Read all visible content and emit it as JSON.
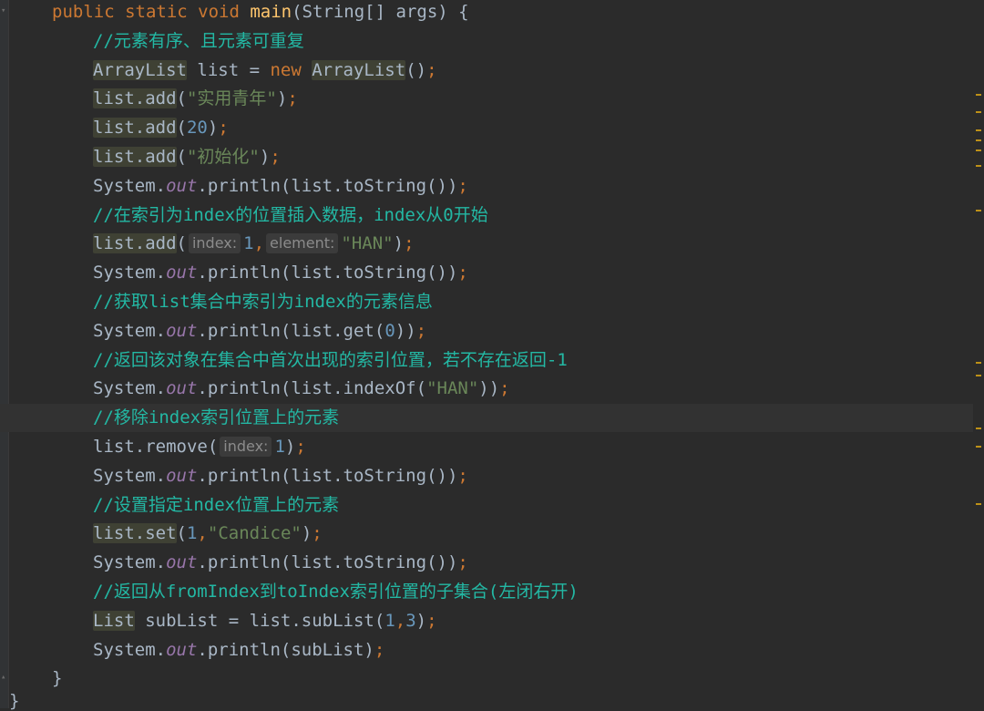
{
  "editor": {
    "colors": {
      "background": "#2b2b2b",
      "default_text": "#a9b7c6",
      "keyword": "#cc7832",
      "method_decl": "#ffc66d",
      "string": "#6a8759",
      "number": "#6897bb",
      "comment": "#23b8a4",
      "static_field": "#9876aa",
      "hint": "#8b8b8b",
      "marker": "#be9117"
    },
    "lines": [
      {
        "indent": 1,
        "tokens": [
          {
            "t": "public static void ",
            "c": "keyword"
          },
          {
            "t": "main",
            "c": "method_decl"
          },
          {
            "t": "(String[] args) {",
            "c": "default_text"
          }
        ]
      },
      {
        "indent": 2,
        "tokens": [
          {
            "t": "//元素有序、且元素可重复",
            "c": "comment"
          }
        ]
      },
      {
        "indent": 2,
        "tokens": [
          {
            "t": "ArrayList",
            "c": "default_text",
            "hl": true
          },
          {
            "t": " list = ",
            "c": "default_text"
          },
          {
            "t": "new ",
            "c": "keyword"
          },
          {
            "t": "ArrayList",
            "c": "default_text",
            "hl": true
          },
          {
            "t": "()",
            "c": "default_text"
          },
          {
            "t": ";",
            "c": "keyword"
          }
        ]
      },
      {
        "indent": 2,
        "tokens": [
          {
            "t": "list.add",
            "c": "default_text",
            "hl": true
          },
          {
            "t": "(",
            "c": "default_text"
          },
          {
            "t": "\"实用青年\"",
            "c": "string"
          },
          {
            "t": ")",
            "c": "default_text"
          },
          {
            "t": ";",
            "c": "keyword"
          }
        ]
      },
      {
        "indent": 2,
        "tokens": [
          {
            "t": "list.add",
            "c": "default_text",
            "hl": true
          },
          {
            "t": "(",
            "c": "default_text"
          },
          {
            "t": "20",
            "c": "number"
          },
          {
            "t": ")",
            "c": "default_text"
          },
          {
            "t": ";",
            "c": "keyword"
          }
        ]
      },
      {
        "indent": 2,
        "tokens": [
          {
            "t": "list.add",
            "c": "default_text",
            "hl": true
          },
          {
            "t": "(",
            "c": "default_text"
          },
          {
            "t": "\"初始化\"",
            "c": "string"
          },
          {
            "t": ")",
            "c": "default_text"
          },
          {
            "t": ";",
            "c": "keyword"
          }
        ]
      },
      {
        "indent": 2,
        "tokens": [
          {
            "t": "System.",
            "c": "default_text"
          },
          {
            "t": "out",
            "c": "static_field",
            "italic": true
          },
          {
            "t": ".println(list.toString())",
            "c": "default_text"
          },
          {
            "t": ";",
            "c": "keyword"
          }
        ]
      },
      {
        "indent": 2,
        "tokens": [
          {
            "t": "//在索引为index的位置插入数据，index从0开始",
            "c": "comment"
          }
        ]
      },
      {
        "indent": 2,
        "tokens": [
          {
            "t": "list.add",
            "c": "default_text",
            "hl": true
          },
          {
            "t": "(",
            "c": "default_text"
          },
          {
            "hint": "index:"
          },
          {
            "t": "1",
            "c": "number"
          },
          {
            "t": ",",
            "c": "keyword"
          },
          {
            "hint": "element:"
          },
          {
            "t": "\"HAN\"",
            "c": "string"
          },
          {
            "t": ")",
            "c": "default_text"
          },
          {
            "t": ";",
            "c": "keyword"
          }
        ]
      },
      {
        "indent": 2,
        "tokens": [
          {
            "t": "System.",
            "c": "default_text"
          },
          {
            "t": "out",
            "c": "static_field",
            "italic": true
          },
          {
            "t": ".println(list.toString())",
            "c": "default_text"
          },
          {
            "t": ";",
            "c": "keyword"
          }
        ]
      },
      {
        "indent": 2,
        "tokens": [
          {
            "t": "//获取list集合中索引为index的元素信息",
            "c": "comment"
          }
        ]
      },
      {
        "indent": 2,
        "tokens": [
          {
            "t": "System.",
            "c": "default_text"
          },
          {
            "t": "out",
            "c": "static_field",
            "italic": true
          },
          {
            "t": ".println(list.get(",
            "c": "default_text"
          },
          {
            "t": "0",
            "c": "number"
          },
          {
            "t": "))",
            "c": "default_text"
          },
          {
            "t": ";",
            "c": "keyword"
          }
        ]
      },
      {
        "indent": 2,
        "tokens": [
          {
            "t": "//返回该对象在集合中首次出现的索引位置，若不存在返回-1",
            "c": "comment"
          }
        ]
      },
      {
        "indent": 2,
        "tokens": [
          {
            "t": "System.",
            "c": "default_text"
          },
          {
            "t": "out",
            "c": "static_field",
            "italic": true
          },
          {
            "t": ".println(list.indexOf(",
            "c": "default_text"
          },
          {
            "t": "\"HAN\"",
            "c": "string"
          },
          {
            "t": "))",
            "c": "default_text"
          },
          {
            "t": ";",
            "c": "keyword"
          }
        ]
      },
      {
        "indent": 2,
        "current": true,
        "tokens": [
          {
            "t": "//移除index索引位置上的元素",
            "c": "comment"
          }
        ]
      },
      {
        "indent": 2,
        "tokens": [
          {
            "t": "list.remove(",
            "c": "default_text"
          },
          {
            "hint": "index:"
          },
          {
            "t": "1",
            "c": "number"
          },
          {
            "t": ")",
            "c": "default_text"
          },
          {
            "t": ";",
            "c": "keyword"
          }
        ]
      },
      {
        "indent": 2,
        "tokens": [
          {
            "t": "System.",
            "c": "default_text"
          },
          {
            "t": "out",
            "c": "static_field",
            "italic": true
          },
          {
            "t": ".println(list.toString())",
            "c": "default_text"
          },
          {
            "t": ";",
            "c": "keyword"
          }
        ]
      },
      {
        "indent": 2,
        "tokens": [
          {
            "t": "//设置指定index位置上的元素",
            "c": "comment"
          }
        ]
      },
      {
        "indent": 2,
        "tokens": [
          {
            "t": "list.set",
            "c": "default_text",
            "hl": true
          },
          {
            "t": "(",
            "c": "default_text"
          },
          {
            "t": "1",
            "c": "number"
          },
          {
            "t": ",",
            "c": "keyword"
          },
          {
            "t": "\"Candice\"",
            "c": "string"
          },
          {
            "t": ")",
            "c": "default_text"
          },
          {
            "t": ";",
            "c": "keyword"
          }
        ]
      },
      {
        "indent": 2,
        "tokens": [
          {
            "t": "System.",
            "c": "default_text"
          },
          {
            "t": "out",
            "c": "static_field",
            "italic": true
          },
          {
            "t": ".println(list.toString())",
            "c": "default_text"
          },
          {
            "t": ";",
            "c": "keyword"
          }
        ]
      },
      {
        "indent": 2,
        "tokens": [
          {
            "t": "//返回从fromIndex到toIndex索引位置的子集合(左闭右开)",
            "c": "comment"
          }
        ]
      },
      {
        "indent": 2,
        "tokens": [
          {
            "t": "List",
            "c": "default_text",
            "hl": true
          },
          {
            "t": " subList = list.subList(",
            "c": "default_text"
          },
          {
            "t": "1",
            "c": "number"
          },
          {
            "t": ",",
            "c": "keyword"
          },
          {
            "t": "3",
            "c": "number"
          },
          {
            "t": ")",
            "c": "default_text"
          },
          {
            "t": ";",
            "c": "keyword"
          }
        ]
      },
      {
        "indent": 2,
        "tokens": [
          {
            "t": "System.",
            "c": "default_text"
          },
          {
            "t": "out",
            "c": "static_field",
            "italic": true
          },
          {
            "t": ".println(subList)",
            "c": "default_text"
          },
          {
            "t": ";",
            "c": "keyword"
          }
        ]
      },
      {
        "indent": 1,
        "tokens": [
          {
            "t": "}",
            "c": "default_text"
          }
        ]
      }
    ],
    "closing_brace": "}"
  }
}
